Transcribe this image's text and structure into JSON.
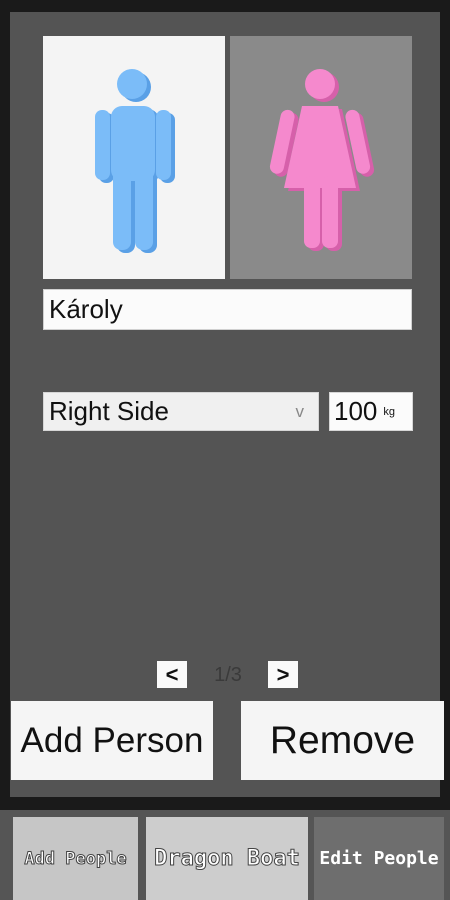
{
  "person": {
    "name": "Károly",
    "side": "Right Side",
    "side_chevron": "v",
    "weight": "100",
    "weight_unit": "kg"
  },
  "gender": {
    "selected": "male",
    "male_icon": "male-figure-icon",
    "female_icon": "female-figure-icon",
    "male_color": "#7bbcf8",
    "female_color": "#f589cd"
  },
  "pager": {
    "prev_label": "<",
    "next_label": ">",
    "indicator": "1/3"
  },
  "actions": {
    "add_label": "Add Person",
    "remove_label": "Remove"
  },
  "tabs": [
    {
      "label": "Add People",
      "active": false
    },
    {
      "label": "Dragon Boat",
      "active": false
    },
    {
      "label": "Edit People",
      "active": true
    }
  ]
}
